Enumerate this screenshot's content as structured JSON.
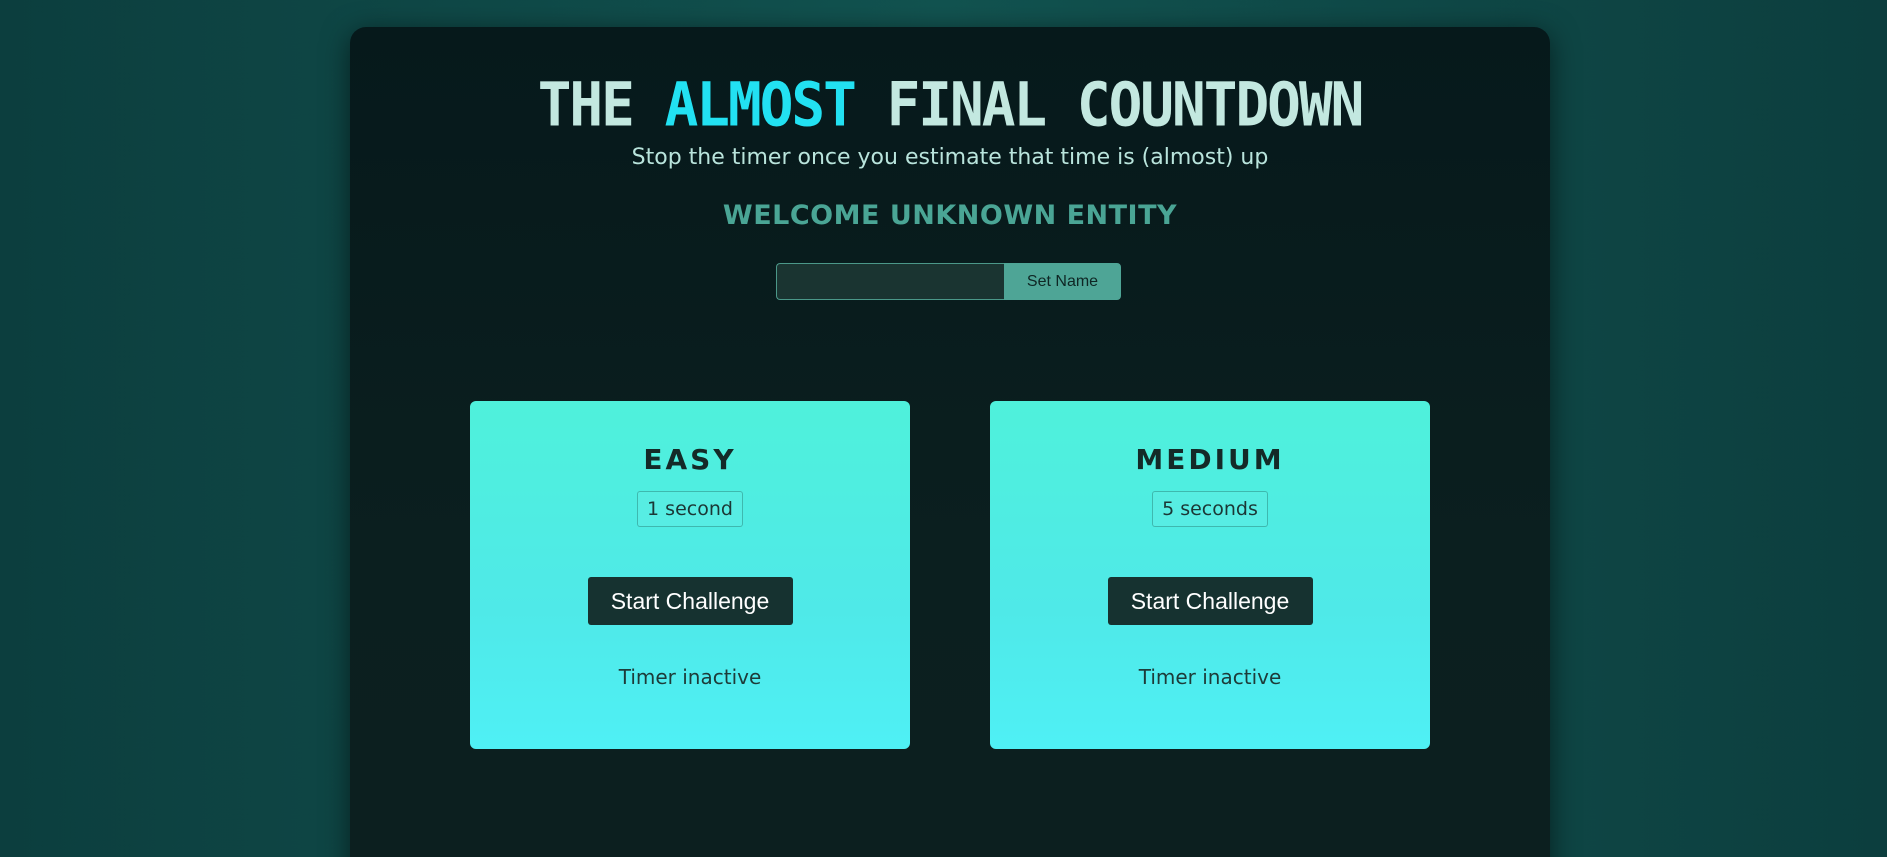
{
  "header": {
    "title_part1": "THE ",
    "title_accent": "ALMOST",
    "title_part2": " FINAL COUNTDOWN",
    "subtitle": "Stop the timer once you estimate that time is (almost) up",
    "welcome": "WELCOME UNKNOWN ENTITY"
  },
  "name_form": {
    "input_value": "",
    "input_placeholder": "",
    "button_label": "Set Name"
  },
  "challenges": [
    {
      "title": "EASY",
      "duration": "1 second",
      "button_label": "Start Challenge",
      "status": "Timer inactive"
    },
    {
      "title": "MEDIUM",
      "duration": "5 seconds",
      "button_label": "Start Challenge",
      "status": "Timer inactive"
    }
  ],
  "colors": {
    "accent": "#22e1f2",
    "card": "#4ff0e6",
    "button_dark": "#163230",
    "set_button": "#4ea596"
  }
}
